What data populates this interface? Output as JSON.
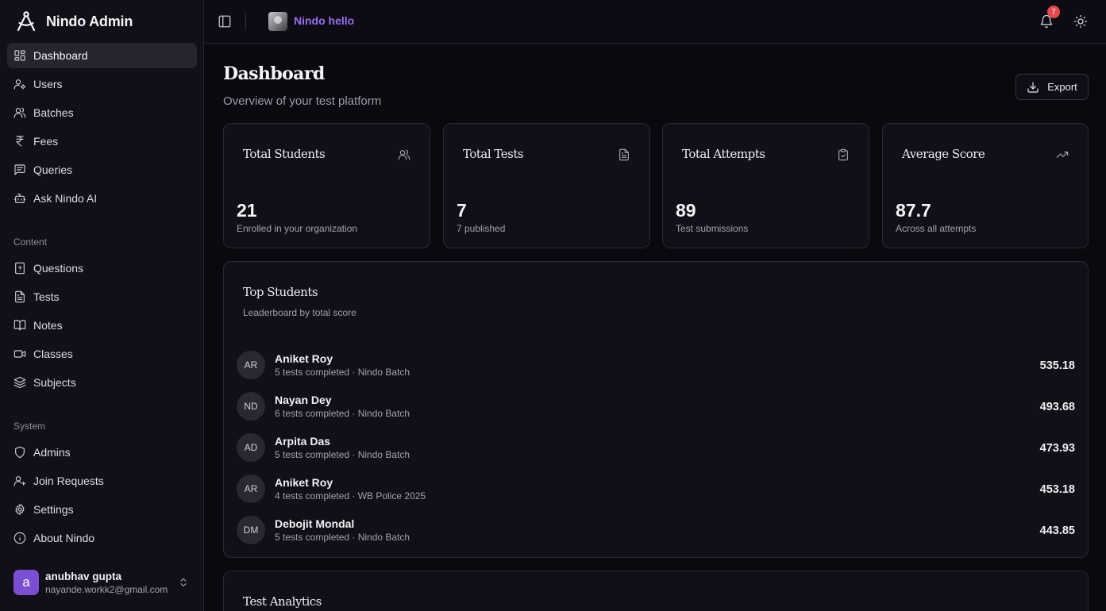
{
  "app": {
    "title": "Nindo Admin",
    "org_name": "Nindo hello",
    "notification_count": "7",
    "accent_color": "#9a6cf0",
    "badge_color": "#e5484d"
  },
  "sidebar": {
    "items": [
      {
        "label": "Dashboard",
        "icon": "layout-dashboard-icon",
        "active": true
      },
      {
        "label": "Users",
        "icon": "user-cog-icon"
      },
      {
        "label": "Batches",
        "icon": "users-icon"
      },
      {
        "label": "Fees",
        "icon": "rupee-icon"
      },
      {
        "label": "Queries",
        "icon": "message-square-text-icon"
      },
      {
        "label": "Ask Nindo AI",
        "icon": "bot-icon"
      }
    ],
    "content_label": "Content",
    "content_items": [
      {
        "label": "Questions",
        "icon": "file-question-icon"
      },
      {
        "label": "Tests",
        "icon": "file-text-icon"
      },
      {
        "label": "Notes",
        "icon": "book-open-icon"
      },
      {
        "label": "Classes",
        "icon": "video-icon"
      },
      {
        "label": "Subjects",
        "icon": "layers-icon"
      }
    ],
    "system_label": "System",
    "system_items": [
      {
        "label": "Admins",
        "icon": "shield-icon"
      },
      {
        "label": "Join Requests",
        "icon": "user-plus-icon"
      },
      {
        "label": "Settings",
        "icon": "gear-icon"
      },
      {
        "label": "About Nindo",
        "icon": "info-icon"
      }
    ],
    "user": {
      "initial": "a",
      "name": "anubhav gupta",
      "email": "nayande.workk2@gmail.com"
    }
  },
  "main": {
    "title": "Dashboard",
    "subtitle": "Overview of your test platform",
    "export_label": "Export",
    "stats": [
      {
        "title": "Total Students",
        "value": "21",
        "desc": "Enrolled in your organization",
        "icon": "users-icon"
      },
      {
        "title": "Total Tests",
        "value": "7",
        "desc": "7 published",
        "icon": "file-text-icon"
      },
      {
        "title": "Total Attempts",
        "value": "89",
        "desc": "Test submissions",
        "icon": "clipboard-check-icon"
      },
      {
        "title": "Average Score",
        "value": "87.7",
        "desc": "Across all attempts",
        "icon": "trending-up-icon"
      }
    ],
    "leaderboard": {
      "title": "Top Students",
      "subtitle": "Leaderboard by total score",
      "rows": [
        {
          "initials": "AR",
          "name": "Aniket Roy",
          "meta": "5 tests completed · Nindo Batch",
          "score": "535.18"
        },
        {
          "initials": "ND",
          "name": "Nayan Dey",
          "meta": "6 tests completed · Nindo Batch",
          "score": "493.68"
        },
        {
          "initials": "AD",
          "name": "Arpita Das",
          "meta": "5 tests completed · Nindo Batch",
          "score": "473.93"
        },
        {
          "initials": "AR",
          "name": "Aniket Roy",
          "meta": "4 tests completed · WB Police 2025",
          "score": "453.18"
        },
        {
          "initials": "DM",
          "name": "Debojit Mondal",
          "meta": "5 tests completed · Nindo Batch",
          "score": "443.85"
        }
      ]
    },
    "analytics": {
      "title": "Test Analytics"
    }
  }
}
